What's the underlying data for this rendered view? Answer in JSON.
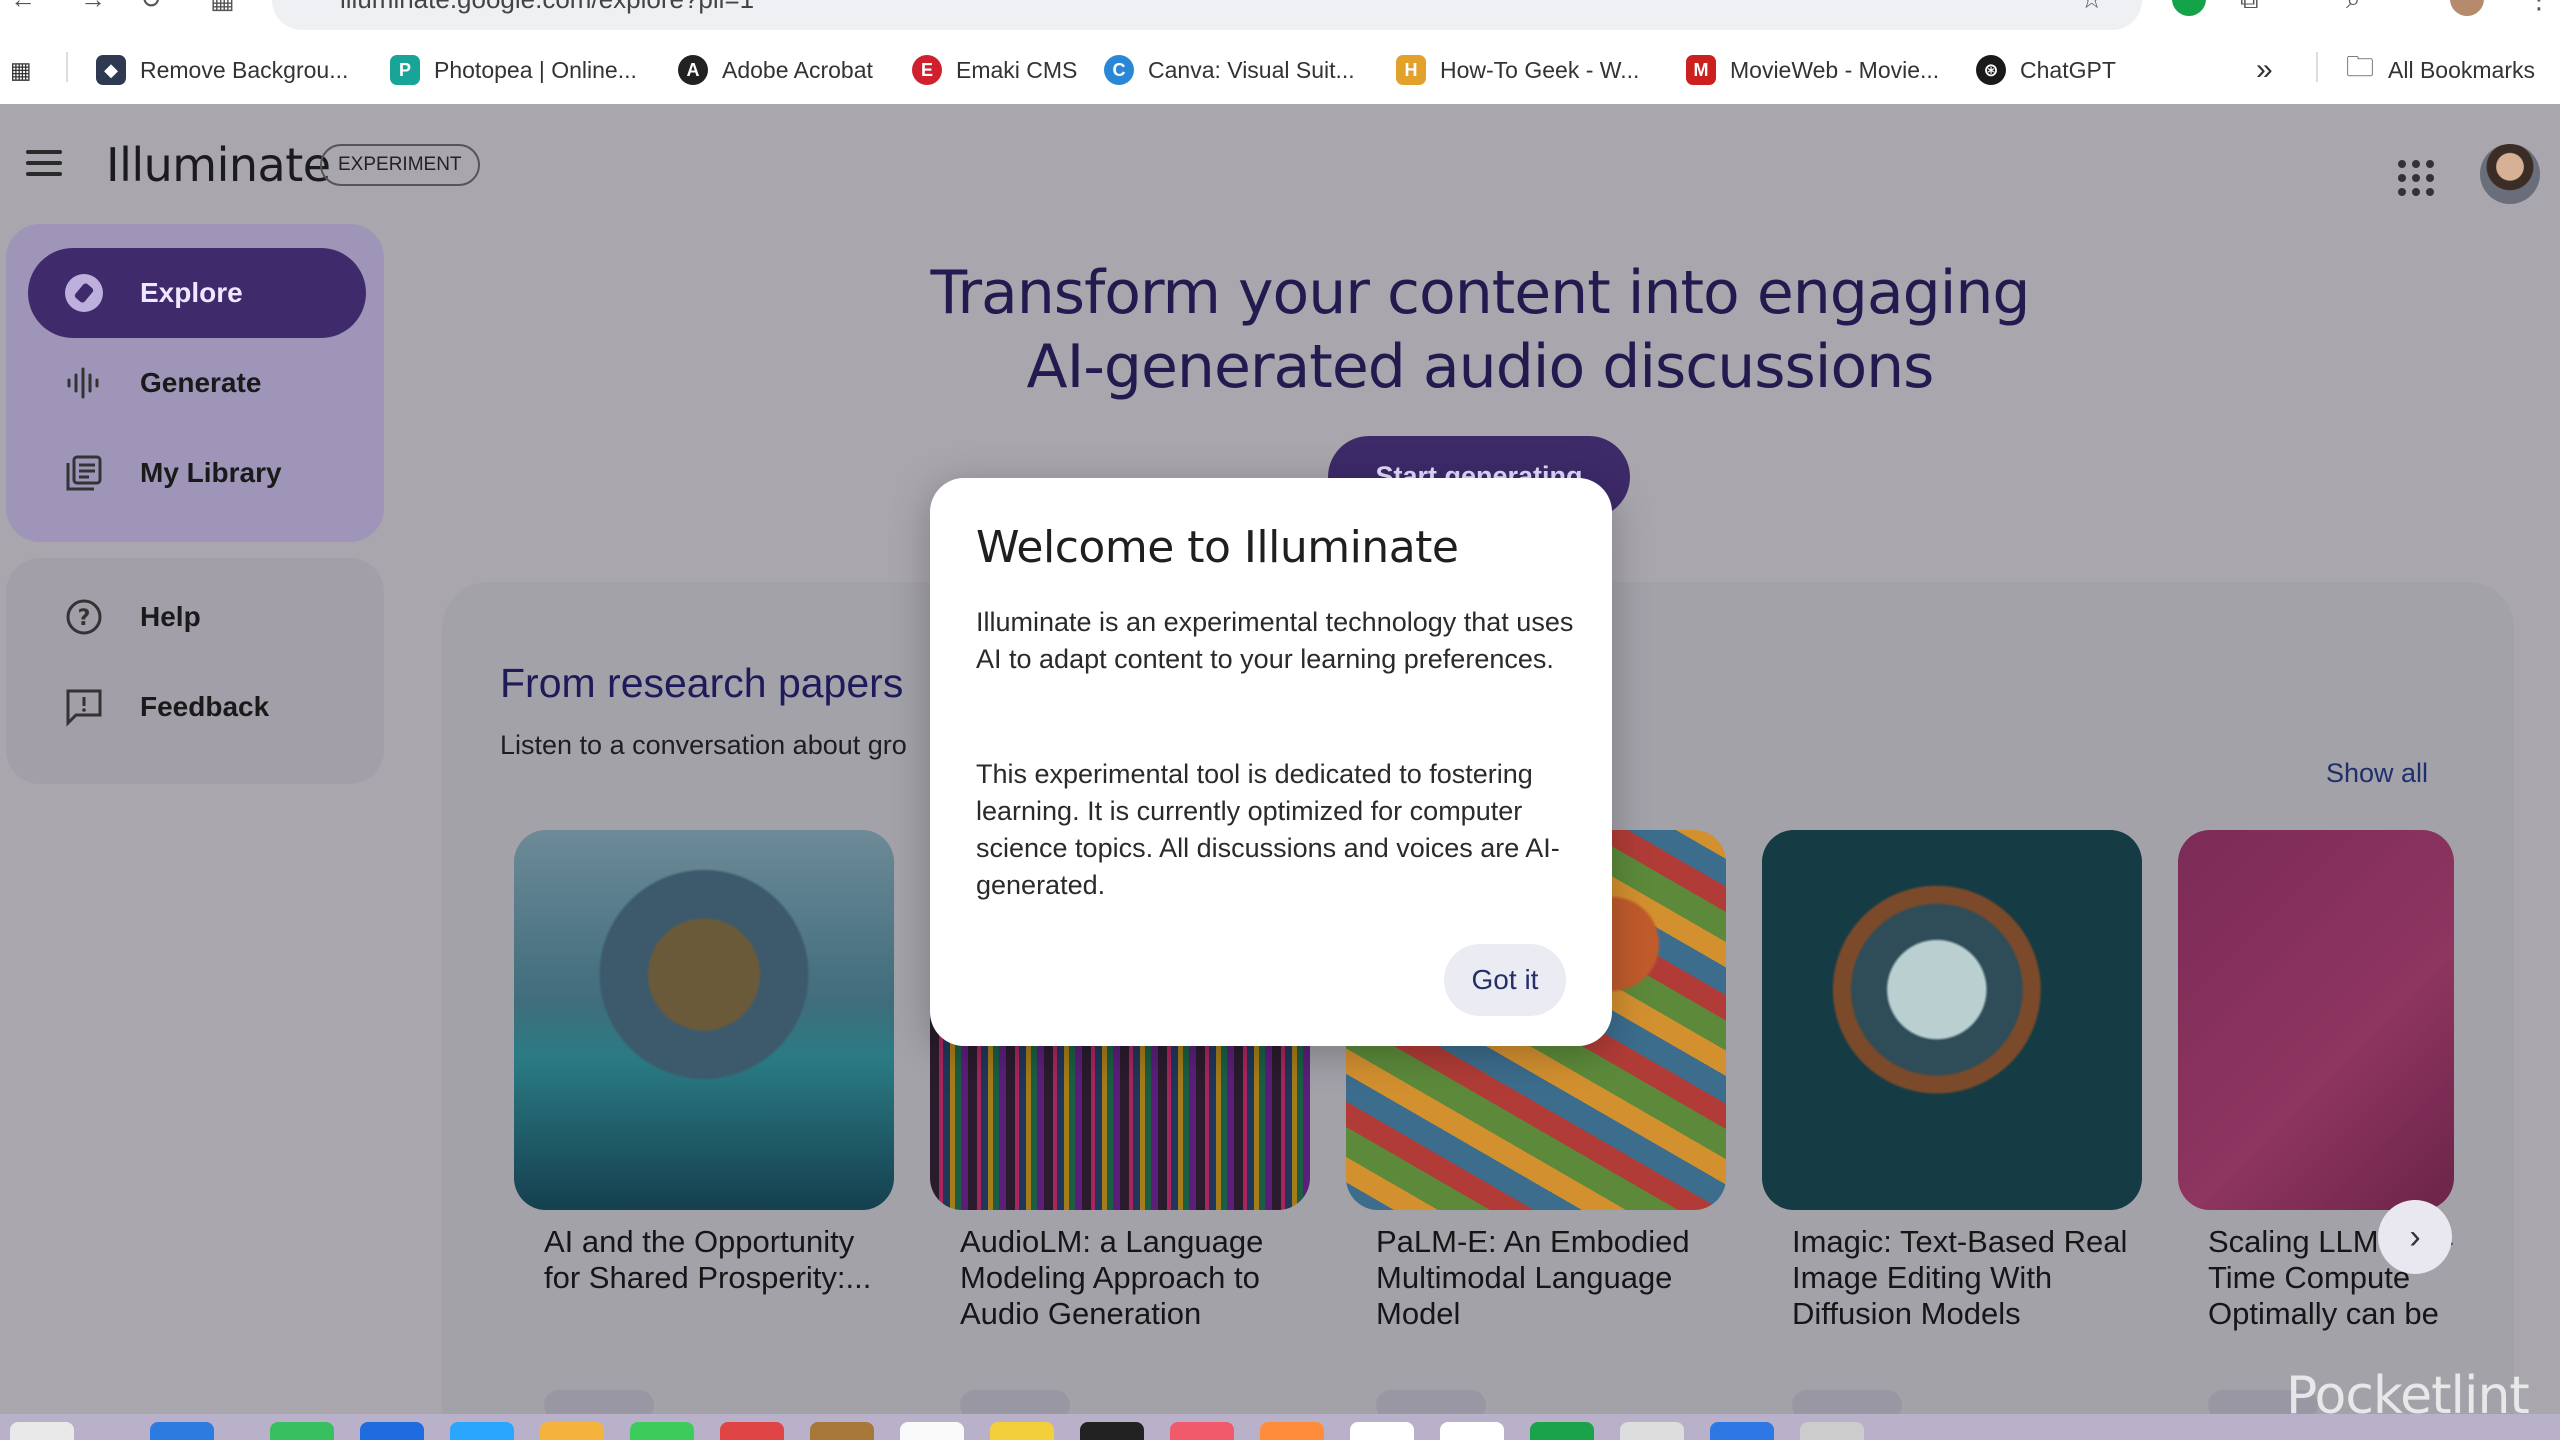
{
  "browser": {
    "url": "illuminate.google.com/explore?pli=1",
    "bookmarks": [
      {
        "label": "Remove Backgrou...",
        "color": "#2f3a52",
        "glyph": "◆"
      },
      {
        "label": "Photopea | Online...",
        "color": "#18a497",
        "glyph": "P"
      },
      {
        "label": "Adobe Acrobat",
        "color": "#222222",
        "glyph": "A"
      },
      {
        "label": "Emaki CMS",
        "color": "#d0202e",
        "glyph": "E"
      },
      {
        "label": "Canva: Visual Suit...",
        "color": "#2a87d8",
        "glyph": "C"
      },
      {
        "label": "How-To Geek - W...",
        "color": "#e1a12b",
        "glyph": "H"
      },
      {
        "label": "MovieWeb - Movie...",
        "color": "#cc1f1f",
        "glyph": "M"
      },
      {
        "label": "ChatGPT",
        "color": "#1a1a1a",
        "glyph": "⊛"
      }
    ],
    "overflow_label": "»",
    "all_bookmarks": "All Bookmarks"
  },
  "app": {
    "title": "Illuminate",
    "badge": "EXPERIMENT"
  },
  "nav": {
    "items": [
      {
        "label": "Explore",
        "icon": "compass-icon",
        "active": true
      },
      {
        "label": "Generate",
        "icon": "audio-wave-icon",
        "active": false
      },
      {
        "label": "My Library",
        "icon": "library-icon",
        "active": false
      }
    ],
    "secondary": [
      {
        "label": "Help",
        "icon": "help-icon"
      },
      {
        "label": "Feedback",
        "icon": "feedback-icon"
      }
    ]
  },
  "hero": {
    "line1": "Transform your content into engaging",
    "line2": "AI-generated audio discussions",
    "cta": "Start generating"
  },
  "section": {
    "title": "From research papers",
    "subtitle": "Listen to a conversation about gro",
    "show_all": "Show all"
  },
  "cards": [
    {
      "title": "AI and the Opportunity for Shared Prosperity:..."
    },
    {
      "title": "AudioLM: a Language Modeling Approach to Audio Generation"
    },
    {
      "title": "PaLM-E: An Embodied Multimodal Language Model"
    },
    {
      "title": "Imagic: Text-Based Real Image Editing With Diffusion Models"
    },
    {
      "title": "Scaling LLM Test-Time Compute Optimally can be"
    }
  ],
  "modal": {
    "title": "Welcome to Illuminate",
    "paragraph1": "Illuminate is an experimental technology that uses AI to adapt content to your learning preferences.",
    "paragraph2": "This experimental tool is dedicated to fostering learning. It is currently optimized for computer science topics. All discussions and voices are AI-generated.",
    "button": "Got it"
  },
  "watermark": "Pocketlint",
  "colors": {
    "primary": "#3f2a6c",
    "nav_card": "#9f95b8",
    "link": "#1e2f6c"
  }
}
